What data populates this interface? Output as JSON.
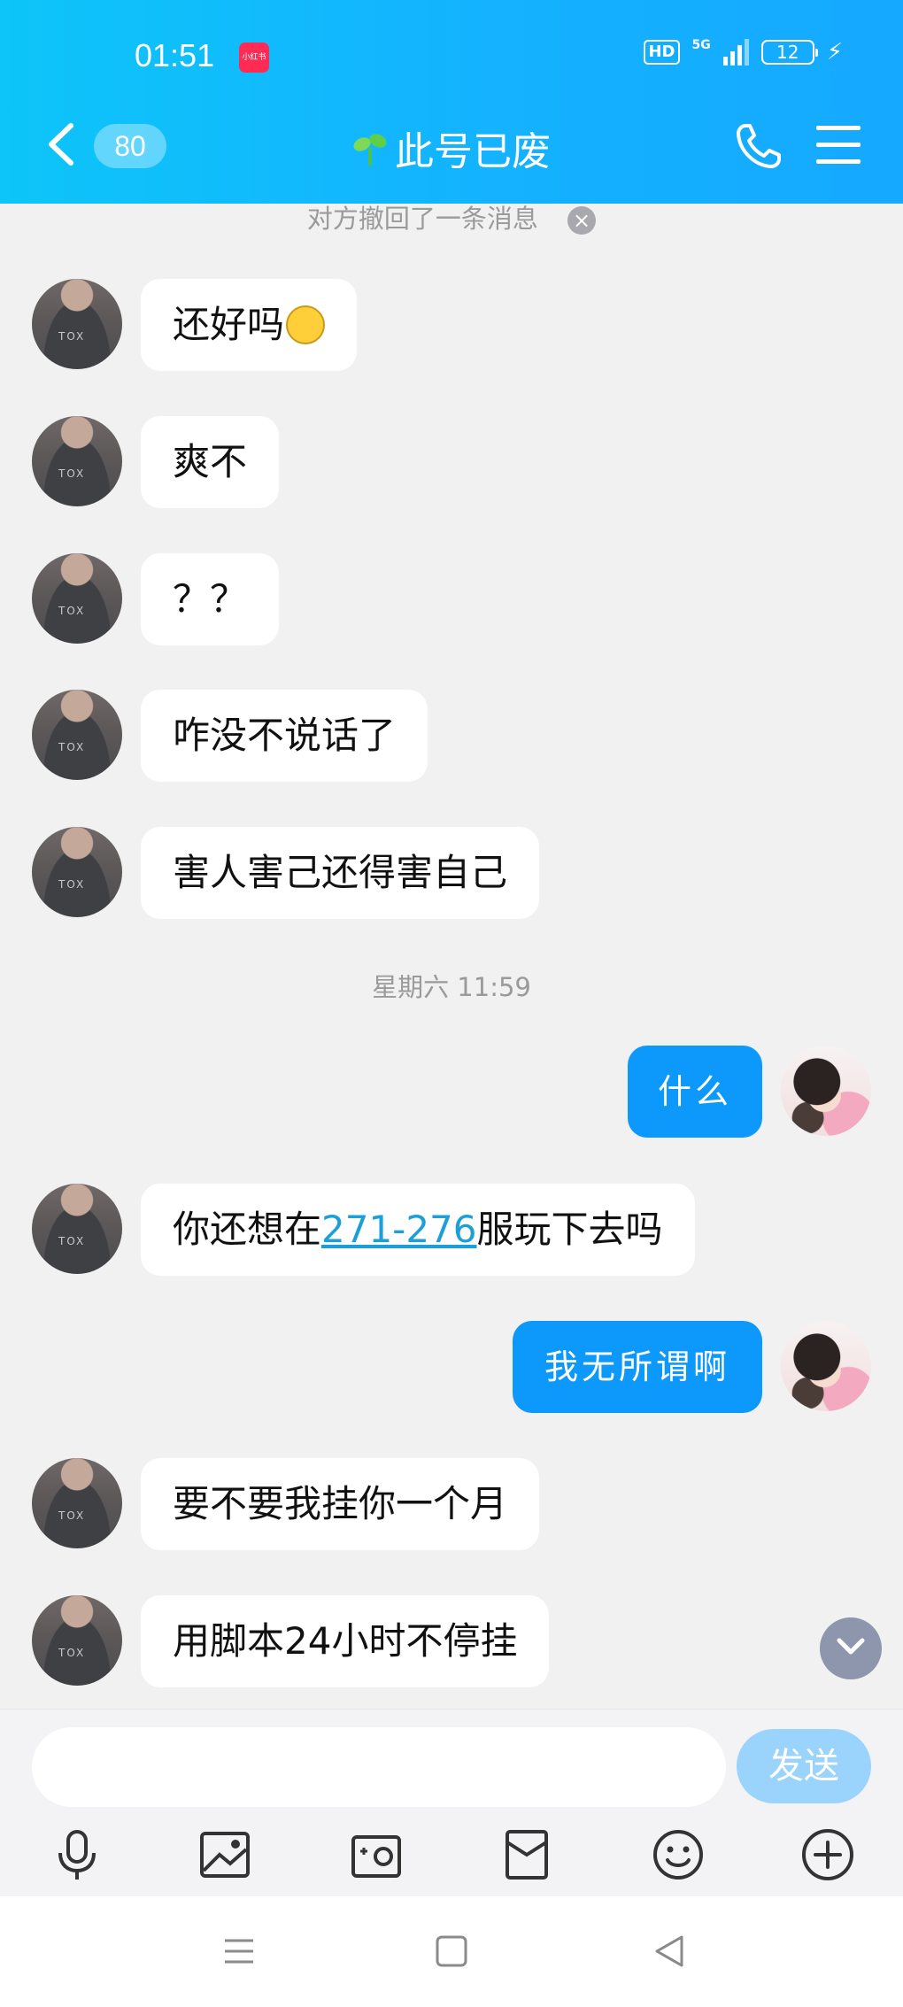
{
  "status_bar": {
    "time": "01:51",
    "app_badge": "小红书",
    "hd": "HD",
    "network": "5G",
    "battery": "12",
    "charging_icon": "lightning-bolt"
  },
  "header": {
    "back_icon": "chevron-left",
    "unread_count": "80",
    "title": "此号已废",
    "title_icon": "sprout",
    "call_icon": "phone",
    "menu_icon": "hamburger-menu"
  },
  "chat": {
    "recall_notice": "对方撤回了一条消息",
    "time_separator": "星期六 11:59",
    "messages": [
      {
        "side": "in",
        "text": "还好吗",
        "has_emoji": true
      },
      {
        "side": "in",
        "text": "爽不"
      },
      {
        "side": "in",
        "text": "？？"
      },
      {
        "side": "in",
        "text": "咋没不说话了"
      },
      {
        "side": "in",
        "text": "害人害己还得害自己"
      },
      {
        "side": "out",
        "text": "什么"
      },
      {
        "side": "in",
        "text_before": "你还想在",
        "link": "271-276",
        "text_after": "服玩下去吗"
      },
      {
        "side": "out",
        "text": "我无所谓啊"
      },
      {
        "side": "in",
        "text": "要不要我挂你一个月"
      },
      {
        "side": "in",
        "text": "用脚本24小时不停挂"
      }
    ]
  },
  "composer": {
    "input_value": "",
    "input_placeholder": "",
    "send_label": "发送",
    "tools": [
      "microphone-icon",
      "image-icon",
      "camera-icon",
      "red-packet-icon",
      "emoji-icon",
      "plus-icon"
    ]
  },
  "colors": {
    "header_gradient_start": "#0dc5f8",
    "header_gradient_end": "#15a9ff",
    "outgoing_bubble": "#0d99fc",
    "incoming_bubble": "#ffffff",
    "background": "#f1f1f1",
    "send_button": "#9ad3fb"
  }
}
